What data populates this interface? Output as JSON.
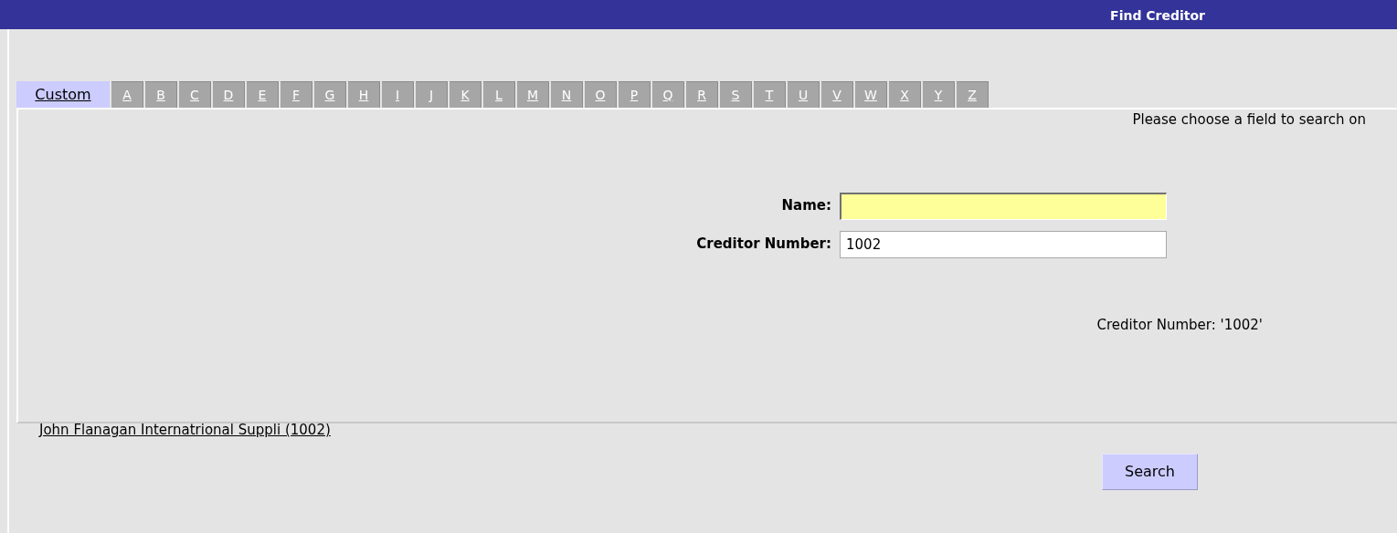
{
  "window": {
    "title": "Find Creditor"
  },
  "tabs": [
    {
      "label": "Custom",
      "selected": true
    },
    {
      "label": "A",
      "selected": false
    },
    {
      "label": "B",
      "selected": false
    },
    {
      "label": "C",
      "selected": false
    },
    {
      "label": "D",
      "selected": false
    },
    {
      "label": "E",
      "selected": false
    },
    {
      "label": "F",
      "selected": false
    },
    {
      "label": "G",
      "selected": false
    },
    {
      "label": "H",
      "selected": false
    },
    {
      "label": "I",
      "selected": false
    },
    {
      "label": "J",
      "selected": false
    },
    {
      "label": "K",
      "selected": false
    },
    {
      "label": "L",
      "selected": false
    },
    {
      "label": "M",
      "selected": false
    },
    {
      "label": "N",
      "selected": false
    },
    {
      "label": "O",
      "selected": false
    },
    {
      "label": "P",
      "selected": false
    },
    {
      "label": "Q",
      "selected": false
    },
    {
      "label": "R",
      "selected": false
    },
    {
      "label": "S",
      "selected": false
    },
    {
      "label": "T",
      "selected": false
    },
    {
      "label": "U",
      "selected": false
    },
    {
      "label": "V",
      "selected": false
    },
    {
      "label": "W",
      "selected": false
    },
    {
      "label": "X",
      "selected": false
    },
    {
      "label": "Y",
      "selected": false
    },
    {
      "label": "Z",
      "selected": false
    }
  ],
  "instruction": "Please choose a field to search on",
  "fields": [
    {
      "label": "Name:",
      "focused": true
    },
    {
      "label": "Creditor Number:",
      "value": "1002",
      "focused": false
    }
  ],
  "criteria": "Creditor Number: '1002'",
  "results": [
    "John Flanagan Internatrional Suppli (1002)"
  ],
  "buttons": [
    "Search"
  ]
}
